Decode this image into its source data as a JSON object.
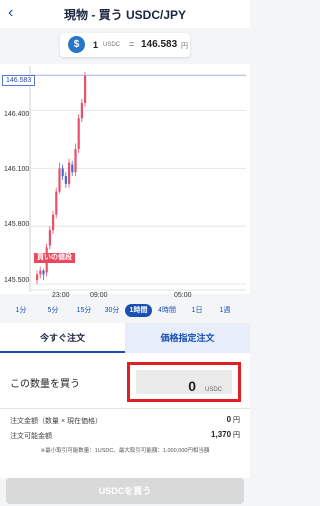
{
  "header": {
    "back_icon": "chevron-left-icon",
    "title": "現物 - 買う USDC/JPY"
  },
  "rate": {
    "coin_symbol": "$",
    "qty": "1",
    "unit": "USDC",
    "eq": "=",
    "value": "146.583",
    "currency": "円"
  },
  "chart": {
    "price_tag": "146.583",
    "y_labels": [
      "146.400",
      "146.100",
      "145.800",
      "145.500"
    ],
    "x_labels": [
      "23:00",
      "09:00",
      "05:00"
    ],
    "buy_tag": "買いの値段",
    "colors": {
      "up": "#e9506a",
      "down": "#3b6fd6",
      "gridline": "#e6e6e6"
    }
  },
  "chart_data": {
    "type": "candlestick",
    "x_labels": [
      "23:00",
      "09:00",
      "05:00"
    ],
    "y_ticks": [
      146.4,
      146.1,
      145.8,
      145.5
    ],
    "ylim": [
      145.49,
      146.6
    ],
    "current_price": 146.583,
    "candles": [
      {
        "o": 145.52,
        "c": 145.55,
        "h": 145.57,
        "l": 145.5,
        "up": true
      },
      {
        "o": 145.55,
        "c": 145.57,
        "h": 145.59,
        "l": 145.53,
        "up": true
      },
      {
        "o": 145.57,
        "c": 145.55,
        "h": 145.58,
        "l": 145.52,
        "up": false
      },
      {
        "o": 145.56,
        "c": 145.69,
        "h": 145.71,
        "l": 145.54,
        "up": true
      },
      {
        "o": 145.7,
        "c": 145.78,
        "h": 145.8,
        "l": 145.68,
        "up": true
      },
      {
        "o": 145.78,
        "c": 145.86,
        "h": 145.88,
        "l": 145.76,
        "up": true
      },
      {
        "o": 145.86,
        "c": 145.98,
        "h": 146.0,
        "l": 145.84,
        "up": true
      },
      {
        "o": 145.98,
        "c": 146.1,
        "h": 146.13,
        "l": 145.97,
        "up": true
      },
      {
        "o": 146.1,
        "c": 146.06,
        "h": 146.12,
        "l": 146.04,
        "up": false
      },
      {
        "o": 146.06,
        "c": 146.02,
        "h": 146.08,
        "l": 146.0,
        "up": false
      },
      {
        "o": 146.02,
        "c": 146.13,
        "h": 146.15,
        "l": 146.0,
        "up": true
      },
      {
        "o": 146.12,
        "c": 146.08,
        "h": 146.14,
        "l": 146.06,
        "up": false
      },
      {
        "o": 146.08,
        "c": 146.2,
        "h": 146.23,
        "l": 146.06,
        "up": true
      },
      {
        "o": 146.2,
        "c": 146.36,
        "h": 146.38,
        "l": 146.18,
        "up": true
      },
      {
        "o": 146.36,
        "c": 146.44,
        "h": 146.46,
        "l": 146.34,
        "up": true
      },
      {
        "o": 146.44,
        "c": 146.58,
        "h": 146.6,
        "l": 146.42,
        "up": true
      }
    ]
  },
  "intervals": [
    "1分",
    "5分",
    "15分",
    "30分",
    "1時間",
    "4時間",
    "1日",
    "1週"
  ],
  "active_interval": "1時間",
  "tabs": {
    "market": "今すぐ注文",
    "limit": "価格指定注文"
  },
  "form": {
    "qty_label": "この数量を買う",
    "qty_value": "0",
    "qty_unit": "USDC",
    "order_amount_label": "注文金額（数量 × 現在価格）",
    "order_amount_value": "0",
    "order_amount_unit": "円",
    "available_label": "注文可能金額",
    "available_value": "1,370",
    "available_unit": "円",
    "note": "※最小取引可能数量：1USDC、最大取引可能額：1,000,000円相当額"
  },
  "buy_button": "USDCを買う"
}
